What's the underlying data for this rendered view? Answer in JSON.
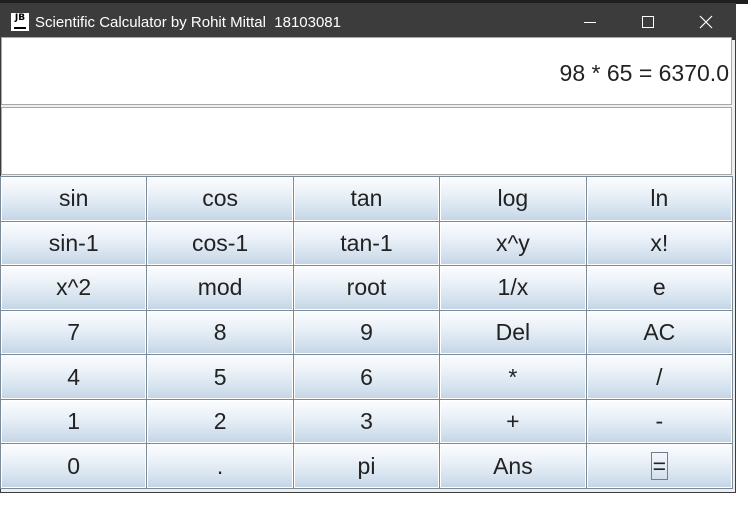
{
  "window": {
    "title": "Scientific Calculator by Rohit Mittal  18103081",
    "icon_text": "JB"
  },
  "display": {
    "expression": "98 * 65 = 6370.0",
    "secondary": ""
  },
  "keys": [
    "sin",
    "cos",
    "tan",
    "log",
    "ln",
    "sin-1",
    "cos-1",
    "tan-1",
    "x^y",
    "x!",
    "x^2",
    "mod",
    "root",
    "1/x",
    "e",
    "7",
    "8",
    "9",
    "Del",
    "AC",
    "4",
    "5",
    "6",
    "*",
    "/",
    "1",
    "2",
    "3",
    "+",
    "-",
    "0",
    ".",
    "pi",
    "Ans",
    "="
  ],
  "focused_key": "=",
  "colors": {
    "titlebar": "#3c3c3c",
    "key_top": "#fbfdff",
    "key_bottom": "#c4d4e4",
    "grid_line": "#7a8a99"
  }
}
